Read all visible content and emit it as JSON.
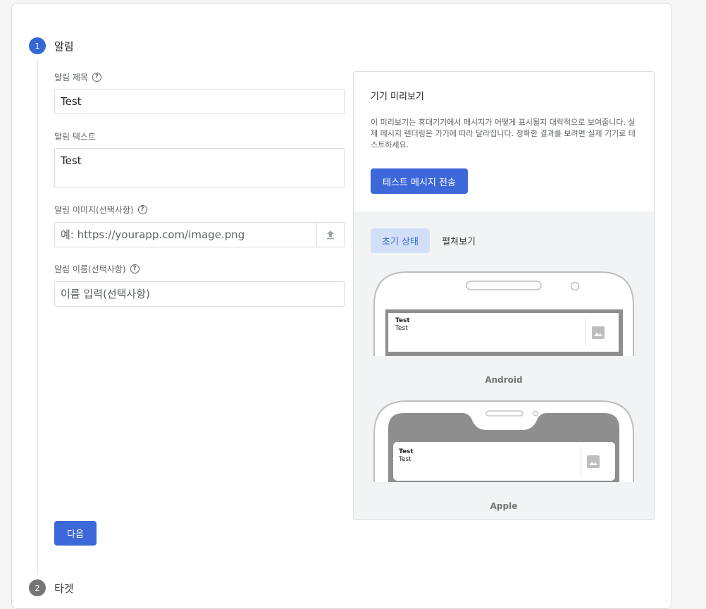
{
  "steps": [
    {
      "number": "1",
      "title": "알림"
    },
    {
      "number": "2",
      "title": "타겟"
    }
  ],
  "form": {
    "title_label": "알림 제목",
    "title_value": "Test",
    "text_label": "알림 텍스트",
    "text_value": "Test",
    "image_label": "알림 이미지(선택사항)",
    "image_placeholder": "예: https://yourapp.com/image.png",
    "name_label": "알림 이름(선택사항)",
    "name_placeholder": "이름 입력(선택사항)",
    "help_glyph": "?",
    "next_label": "다음"
  },
  "preview": {
    "title": "기기 미리보기",
    "description": "이 미리보기는 휴대기기에서 메시지가 어떻게 표시될지 대략적으로 보여줍니다. 실제 메시지 렌더링은 기기에 따라 달라집니다. 정확한 결과를 보려면 실제 기기로 테스트하세요.",
    "send_button": "테스트 메시지 전송",
    "tabs": [
      {
        "label": "초기 상태",
        "active": true
      },
      {
        "label": "펼쳐보기",
        "active": false
      }
    ],
    "devices": [
      {
        "label": "Android",
        "notif_title": "Test",
        "notif_text": "Test"
      },
      {
        "label": "Apple",
        "notif_title": "Test",
        "notif_text": "Test"
      }
    ]
  },
  "colors": {
    "primary": "#3d68da",
    "tab_active_bg": "#d2e0f7",
    "step_inactive": "#757575"
  }
}
